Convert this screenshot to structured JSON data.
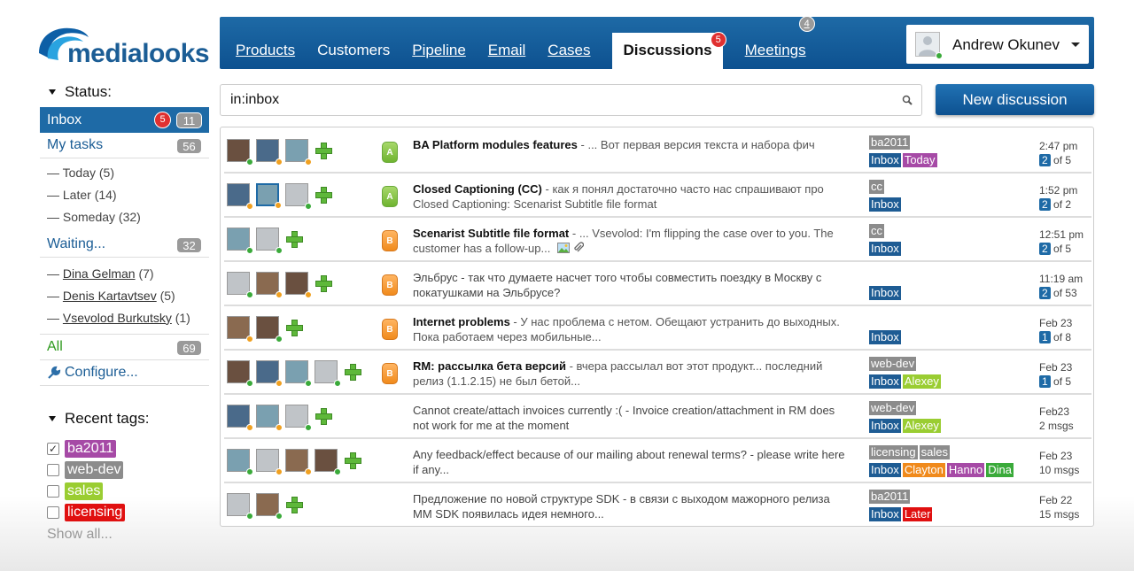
{
  "brand": {
    "logo_text": "medialooks"
  },
  "nav": {
    "items": [
      {
        "label": "Products",
        "link": true
      },
      {
        "label": "Customers",
        "link": false
      },
      {
        "label": "Pipeline",
        "link": true
      },
      {
        "label": "Email",
        "link": true
      },
      {
        "label": "Cases",
        "link": true
      },
      {
        "label": "Discussions",
        "active": true,
        "badge": "5",
        "badge_color": "#e03030"
      },
      {
        "label": "Meetings",
        "link": true,
        "badge": "4",
        "badge_color": "#9a9a9a"
      }
    ]
  },
  "user": {
    "name": "Andrew Okunev"
  },
  "sidebar": {
    "status_title": "Status:",
    "inbox": {
      "label": "Inbox",
      "unread": "5",
      "count": "11"
    },
    "my_tasks": {
      "label": "My tasks",
      "count": "56"
    },
    "task_subs": [
      "— Today (5)",
      "— Later (14)",
      "— Someday (32)"
    ],
    "waiting": {
      "label": "Waiting...",
      "count": "32"
    },
    "people": [
      {
        "name": "Dina Gelman",
        "count": "(7)"
      },
      {
        "name": "Denis Kartavtsev",
        "count": "(5)"
      },
      {
        "name": "Vsevolod Burkutsky",
        "count": "(1)"
      }
    ],
    "all": {
      "label": "All",
      "count": "69"
    },
    "configure": "Configure...",
    "recent_title": "Recent tags:",
    "recent_tags": [
      {
        "label": "ba2011",
        "color": "#a64aa6",
        "checked": true
      },
      {
        "label": "web-dev",
        "color": "#8c8c8c",
        "checked": false
      },
      {
        "label": "sales",
        "color": "#9acd32",
        "checked": false
      },
      {
        "label": "licensing",
        "color": "#e01010",
        "checked": false
      }
    ],
    "show_all": "Show all..."
  },
  "search": {
    "value": "in:inbox",
    "placeholder": ""
  },
  "new_discussion": "New discussion",
  "tag_colors": {
    "ba2011": "#8c8c8c",
    "cc": "#8c8c8c",
    "web-dev": "#8c8c8c",
    "licensing": "#8c8c8c",
    "sales": "#8c8c8c",
    "Inbox": "#1e5c94",
    "Today": "#a64aa6",
    "Alexey": "#9acd32",
    "Clayton": "#f08a1c",
    "Hanno": "#a64aa6",
    "Dina": "#3aaa3a",
    "Later": "#e01010"
  },
  "discussions": [
    {
      "avatars": [
        "green",
        "orange",
        "orange"
      ],
      "priority": "A",
      "title": "BA Platform modules features",
      "snippet": " - ... Вот первая версия текста и набора фич",
      "tags1": [
        "ba2011"
      ],
      "tags2": [
        "Inbox",
        "Today"
      ],
      "time": "2:47 pm",
      "count": "2",
      "of": " of 5"
    },
    {
      "avatars": [
        "orange",
        "orange",
        "green"
      ],
      "selected": 1,
      "priority": "A",
      "title": "Closed Captioning (CC)",
      "snippet": " - как я понял достаточно часто нас спрашивают про Closed Captioning: Scenarist Subtitle file format",
      "tags1": [
        "cc"
      ],
      "tags2": [
        "Inbox"
      ],
      "time": "1:52 pm",
      "count": "2",
      "of": " of 2"
    },
    {
      "avatars": [
        "green",
        "green"
      ],
      "priority": "B",
      "title": "Scenarist Subtitle file format",
      "snippet": " - ... Vsevolod: I'm flipping the case over to you.  The customer has a follow-up...",
      "attach": true,
      "tags1": [
        "cc"
      ],
      "tags2": [
        "Inbox"
      ],
      "time": "12:51 pm",
      "count": "2",
      "of": " of 5"
    },
    {
      "avatars": [
        "green",
        "orange",
        "orange"
      ],
      "priority": "B",
      "title": "",
      "plain": "Эльбрус - так что думаете насчет того чтобы совместить поездку в Москву с покатушками на Эльбрусе?",
      "tags1": [],
      "tags2": [
        "Inbox"
      ],
      "time": "11:19 am",
      "count": "2",
      "of": " of 53"
    },
    {
      "avatars": [
        "orange",
        "green"
      ],
      "priority": "B",
      "title": "Internet problems",
      "snippet": " - У нас проблема с нетом. Обещают устранить до выходных. Пока работаем через мобильные...",
      "tags1": [],
      "tags2": [
        "Inbox"
      ],
      "time": "Feb 23",
      "count": "1",
      "of": " of 8"
    },
    {
      "avatars": [
        "green",
        "orange",
        "green",
        "green"
      ],
      "priority": "B",
      "title": "RM: рассылка бета версий",
      "snippet": " - вчера рассылал вот этот продукт... последний релиз (1.1.2.15) не был бетой...",
      "tags1": [
        "web-dev"
      ],
      "tags2": [
        "Inbox",
        "Alexey"
      ],
      "time": "Feb 23",
      "count": "1",
      "of": " of 5"
    },
    {
      "avatars": [
        "orange",
        "orange",
        "green"
      ],
      "priority": "",
      "title": "",
      "plain": "Cannot create/attach invoices currently :( - Invoice creation/attachment in RM does not work for me at the moment",
      "tags1": [
        "web-dev"
      ],
      "tags2": [
        "Inbox",
        "Alexey"
      ],
      "time": "Feb23",
      "msgs": "2 msgs"
    },
    {
      "avatars": [
        "green",
        "orange",
        "orange",
        "green"
      ],
      "priority": "",
      "title": "",
      "plain": "Any feedback/effect because of our mailing about renewal terms? - please write here if any...",
      "tags1": [
        "licensing",
        "sales"
      ],
      "tags2": [
        "Inbox",
        "Clayton",
        "Hanno",
        "Dina"
      ],
      "time": "Feb 23",
      "msgs": "10 msgs"
    },
    {
      "avatars": [
        "green",
        "green"
      ],
      "priority": "",
      "title": "",
      "plain": "Предложение по новой структуре SDK - в связи с выходом мажорного релиза MM SDK появилась идея немного...",
      "tags1": [
        "ba2011"
      ],
      "tags2": [
        "Inbox",
        "Later"
      ],
      "time": "Feb 22",
      "msgs": "15 msgs"
    }
  ]
}
